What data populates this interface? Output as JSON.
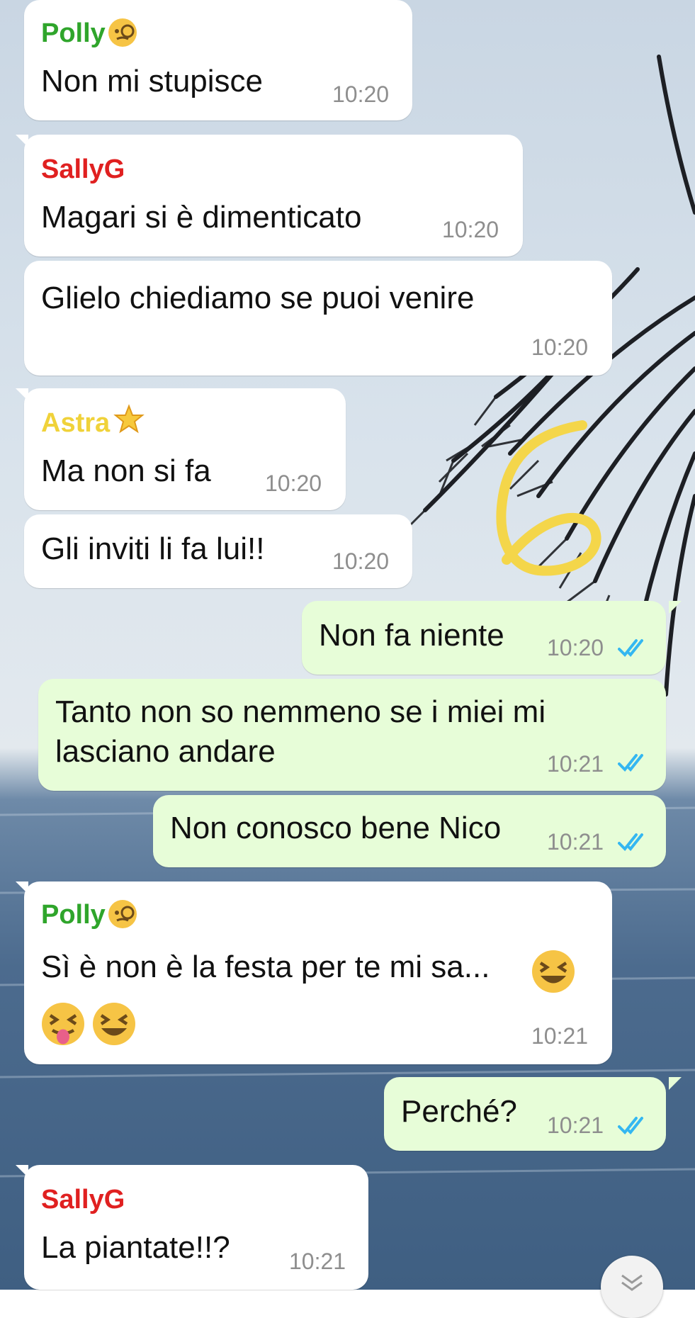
{
  "colors": {
    "incoming_bubble": "#ffffff",
    "outgoing_bubble": "#e7fdd8",
    "polly": "#2fa52b",
    "sally": "#e02020",
    "astra": "#f0d23a",
    "tick_read": "#34b7f1",
    "time": "#8e8e8e"
  },
  "messages": [
    {
      "sender": "Polly",
      "sender_emoji": "monocle-face",
      "text": "Non mi stupisce",
      "time": "10:20"
    },
    {
      "sender": "SallyG",
      "text": "Magari si è dimenticato",
      "time": "10:20"
    },
    {
      "text": "Glielo chiediamo se puoi venire",
      "time": "10:20"
    },
    {
      "sender": "Astra",
      "sender_emoji": "glowing-star",
      "text": "Ma non si fa",
      "time": "10:20"
    },
    {
      "text": "Gli inviti li fa lui!!",
      "time": "10:20"
    },
    {
      "outgoing": true,
      "text": "Non fa niente",
      "time": "10:20",
      "status": "read"
    },
    {
      "outgoing": true,
      "text_line1": "Tanto non so nemmeno se i miei mi",
      "text_line2": "lasciano andare",
      "time": "10:21",
      "status": "read"
    },
    {
      "outgoing": true,
      "text": "Non conosco bene Nico",
      "time": "10:21",
      "status": "read"
    },
    {
      "sender": "Polly",
      "sender_emoji": "monocle-face",
      "text": "Sì è non è la festa per te mi sa...",
      "emojis": [
        "grinning-squinting-face",
        "squinting-face-with-tongue",
        "grinning-squinting-face"
      ],
      "time": "10:21"
    },
    {
      "outgoing": true,
      "text": "Perché?",
      "time": "10:21",
      "status": "read"
    },
    {
      "sender": "SallyG",
      "text": "La piantate!!?",
      "time": "10:21"
    }
  ],
  "scroll_button_icon": "chevron-double-down-icon",
  "annotation": "6"
}
